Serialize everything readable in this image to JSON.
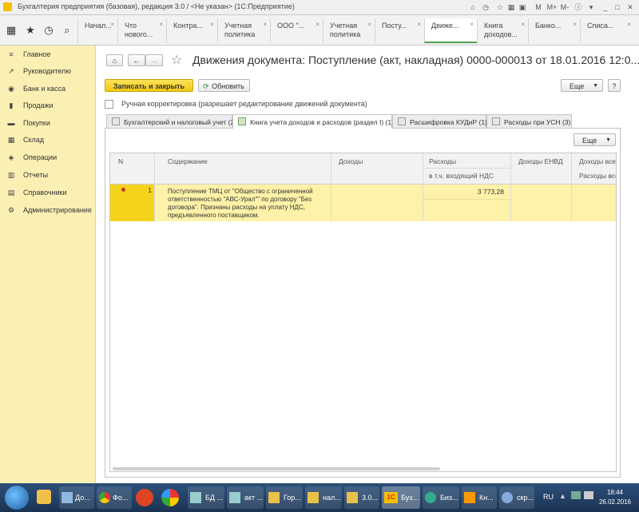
{
  "window": {
    "title": "Бухгалтерия предприятия (базовая), редакция 3.0 / <Не указан> (1С:Предприятие)",
    "controls": [
      "M",
      "M+",
      "M-"
    ]
  },
  "tabs": [
    {
      "label": "Начал..."
    },
    {
      "label": "Что нового..."
    },
    {
      "label": "Контра..."
    },
    {
      "label": "Учетная политика"
    },
    {
      "label": "ООО \"..."
    },
    {
      "label": "Учетная политика"
    },
    {
      "label": "Посту..."
    },
    {
      "label": "Движе...",
      "active": true
    },
    {
      "label": "Книга доходов..."
    },
    {
      "label": "Банко..."
    },
    {
      "label": "Списа..."
    }
  ],
  "sidebar": {
    "items": [
      {
        "label": "Главное",
        "icon": "≡"
      },
      {
        "label": "Руководителю",
        "icon": "↗"
      },
      {
        "label": "Банк и касса",
        "icon": "◉"
      },
      {
        "label": "Продажи",
        "icon": "▮"
      },
      {
        "label": "Покупки",
        "icon": "▬"
      },
      {
        "label": "Склад",
        "icon": "▦"
      },
      {
        "label": "Операции",
        "icon": "◈"
      },
      {
        "label": "Отчеты",
        "icon": "▥"
      },
      {
        "label": "Справочники",
        "icon": "▤"
      },
      {
        "label": "Администрирование",
        "icon": "⚙"
      }
    ]
  },
  "document": {
    "title": "Движения документа: Поступление (акт, накладная) 0000-000013 от 18.01.2016 12:0..."
  },
  "toolbar": {
    "save_close": "Записать и закрыть",
    "refresh": "Обновить",
    "more": "Еще",
    "help": "?"
  },
  "manual_correction": {
    "label": "Ручная корректировка (разрешает редактирование движений документа)",
    "checked": false
  },
  "doc_tabs": [
    {
      "label": "Бухгалтерский и налоговый учет (2)",
      "icon_color": "#e6e6e6"
    },
    {
      "label": "Книга учета доходов и расходов (раздел I) (1)",
      "active": true,
      "icon_color": "#cfe6c7"
    },
    {
      "label": "Расшифровка КУДиР (1)",
      "icon_color": "#e6e6e6"
    },
    {
      "label": "Расходы при УСН (3)",
      "icon_color": "#e6e6e6"
    }
  ],
  "table_more": "Еще",
  "table": {
    "columns": {
      "n": "N",
      "content": "Содержание",
      "income": "Доходы",
      "expenses": "Расходы",
      "expenses_vat": "в т.ч. входящий НДС",
      "envd_income": "Доходы ЕНВД",
      "income_all": "Доходы всег",
      "expenses_all": "Расходы всег"
    },
    "rows": [
      {
        "n": "1",
        "content": "Поступление ТМЦ от \"Общество с ограниченной ответственностью \"АВС-Урал\"\" по договору \"Без договора\". Признаны расходы на уплату НДС, предъявленного поставщиком.",
        "income": "",
        "expenses": "3 773,28"
      }
    ]
  },
  "taskbar": {
    "items": [
      "До...",
      "Фо...",
      "БД ...",
      "акт ...",
      "Гор...",
      "нал...",
      "3.0...",
      "Бух...",
      "Биз...",
      "Кн...",
      "скр..."
    ],
    "lang": "RU",
    "time": "18:44",
    "date": "26.02.2016"
  }
}
